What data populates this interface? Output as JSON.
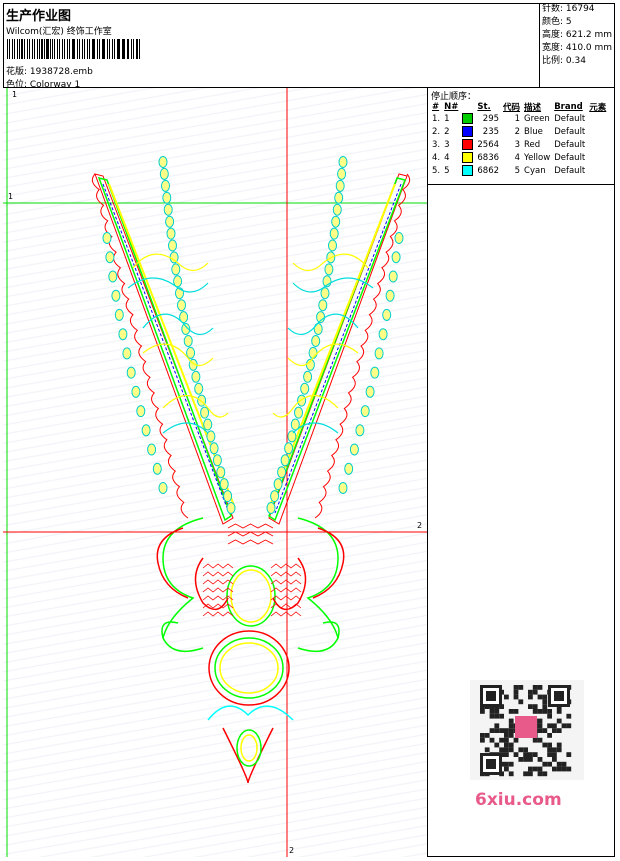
{
  "header": {
    "title": "生产作业图",
    "company": "Wilcom(汇宏) 终饰工作室",
    "file_label": "花版: 1938728.emb",
    "colorway_label": "色位: Colorway 1"
  },
  "stats": {
    "stitches": "针数: 16794",
    "colors": "颜色: 5",
    "height": "高度: 621.2 mm",
    "width": "宽度: 410.0 mm",
    "scale": "比例: 0.34"
  },
  "stop_panel": {
    "heading": "停止顺序：",
    "columns": [
      "#",
      "N#",
      "St.",
      "代码",
      "描述",
      "Brand",
      "元素"
    ],
    "rows": [
      {
        "idx": "1.",
        "n": "1",
        "color": "#00cc00",
        "st": "295",
        "code": "1",
        "desc": "Green",
        "brand": "Default"
      },
      {
        "idx": "2.",
        "n": "2",
        "color": "#0000ff",
        "st": "235",
        "code": "2",
        "desc": "Blue",
        "brand": "Default"
      },
      {
        "idx": "3.",
        "n": "3",
        "color": "#ff0000",
        "st": "2564",
        "code": "3",
        "desc": "Red",
        "brand": "Default"
      },
      {
        "idx": "4.",
        "n": "4",
        "color": "#ffff00",
        "st": "6836",
        "code": "4",
        "desc": "Yellow",
        "brand": "Default"
      },
      {
        "idx": "5.",
        "n": "5",
        "color": "#00ffff",
        "st": "6862",
        "code": "5",
        "desc": "Cyan",
        "brand": "Default"
      }
    ]
  },
  "axis": {
    "top": "1",
    "left": "1",
    "right": "2",
    "bottom": "2"
  },
  "watermark": "6xiu.com"
}
